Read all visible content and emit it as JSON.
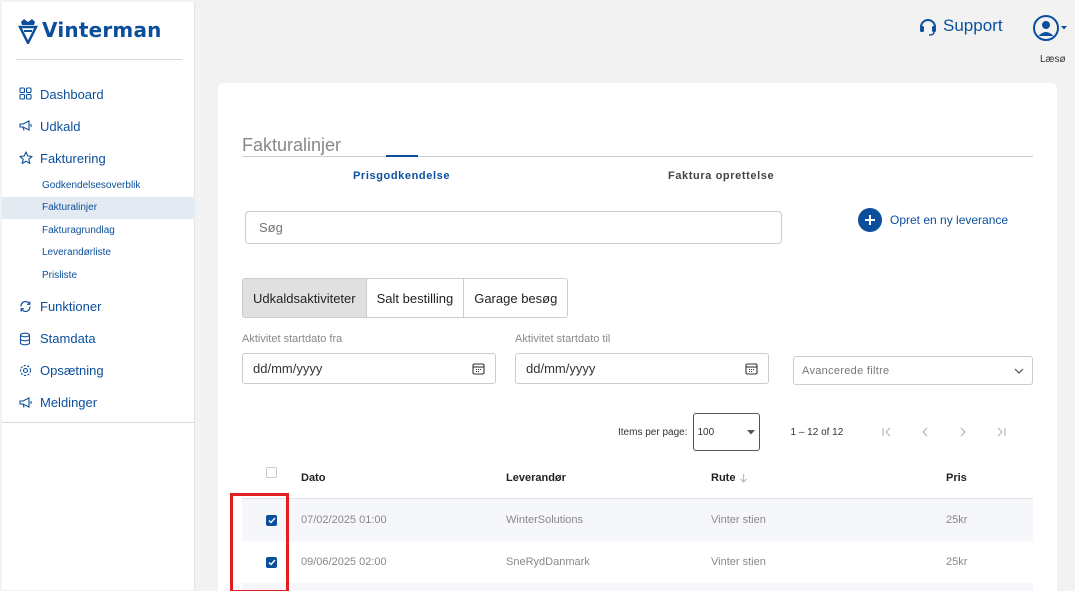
{
  "brand": {
    "name": "Vinterman",
    "color": "#0b4f9c"
  },
  "sidebar": {
    "items": [
      {
        "label": "Dashboard",
        "icon": "grid-icon"
      },
      {
        "label": "Udkald",
        "icon": "megaphone-icon"
      },
      {
        "label": "Fakturering",
        "icon": "star-icon"
      }
    ],
    "sub_items": [
      {
        "label": "Godkendelsesoverblik"
      },
      {
        "label": "Fakturalinjer",
        "active": true
      },
      {
        "label": "Fakturagrundlag"
      },
      {
        "label": "Leverandørliste"
      },
      {
        "label": "Prisliste"
      }
    ],
    "items_after": [
      {
        "label": "Funktioner",
        "icon": "refresh-icon"
      },
      {
        "label": "Stamdata",
        "icon": "database-icon"
      },
      {
        "label": "Opsætning",
        "icon": "gear-icon"
      },
      {
        "label": "Meldinger",
        "icon": "megaphone-icon"
      }
    ]
  },
  "header": {
    "support_label": "Support",
    "user_name": "Læsø"
  },
  "page": {
    "title": "Fakturalinjer",
    "tabs": [
      {
        "label": "Prisgodkendelse",
        "active": true
      },
      {
        "label": "Faktura oprettelse",
        "active": false
      }
    ],
    "search_placeholder": "Søg",
    "new_delivery_label": "Opret en ny leverance",
    "segments": [
      {
        "label": "Udkaldsaktiviteter",
        "active": true
      },
      {
        "label": "Salt bestilling",
        "active": false
      },
      {
        "label": "Garage besøg",
        "active": false
      }
    ],
    "filters": {
      "start_from_label": "Aktivitet startdato fra",
      "start_from_value": "dd/mm/yyyy",
      "start_to_label": "Aktivitet startdato til",
      "start_to_value": "dd/mm/yyyy",
      "advanced_label": "Avancerede filtre"
    },
    "paginator": {
      "items_per_page_label": "Items per page:",
      "page_size": "100",
      "range_label": "1 – 12 of 12"
    },
    "table": {
      "columns": [
        "Dato",
        "Leverandør",
        "Rute",
        "Pris"
      ],
      "rows": [
        {
          "dato": "07/02/2025 01:00",
          "leverandor": "WinterSolutions",
          "rute": "Vinter stien",
          "pris": "25kr",
          "checked": true
        },
        {
          "dato": "09/06/2025 02:00",
          "leverandor": "SneRydDanmark",
          "rute": "Vinter stien",
          "pris": "25kr",
          "checked": true
        }
      ]
    }
  }
}
